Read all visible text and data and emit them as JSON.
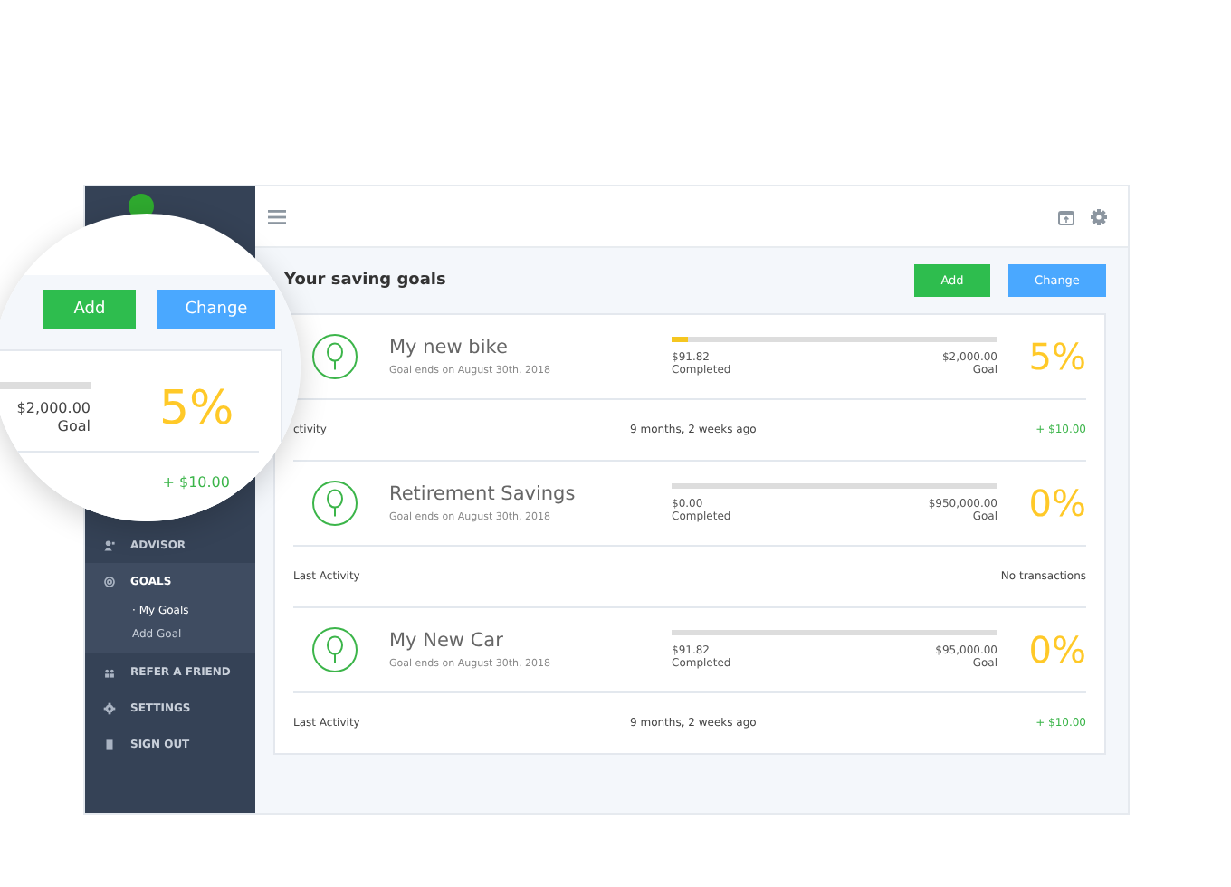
{
  "sidebar": {
    "items": [
      {
        "label": "ADVISOR",
        "kind": "advisor",
        "selected": false
      },
      {
        "label": "GOALS",
        "kind": "goals",
        "selected": true,
        "expanded": true,
        "children": [
          {
            "label": "· My Goals",
            "selected": true
          },
          {
            "label": "Add Goal",
            "selected": false
          }
        ]
      },
      {
        "label": "REFER A FRIEND",
        "kind": "refer",
        "selected": false
      },
      {
        "label": "SETTINGS",
        "kind": "settings",
        "selected": false
      },
      {
        "label": "SIGN OUT",
        "kind": "signout",
        "selected": false
      }
    ]
  },
  "header": {
    "title": "Your saving goals",
    "buttons": [
      {
        "label": "Add",
        "kind": "add"
      },
      {
        "label": "Change",
        "kind": "change"
      }
    ]
  },
  "goals": [
    {
      "name": "My new bike",
      "ends": "Goal ends on August 30th, 2018",
      "completed": "$91.82",
      "completed_label": "Completed",
      "goal": "$2,000.00",
      "goal_label": "Goal",
      "level": 0.05,
      "percent": "5%",
      "activity": {
        "label": "ctivity",
        "time": "9 months, 2 weeks ago",
        "value": "+ $10.00",
        "color": "#3cb54a"
      }
    },
    {
      "name": "Retirement Savings",
      "ends": "Goal ends on August 30th, 2018",
      "completed": "$0.00",
      "completed_label": "Completed",
      "goal": "$950,000.00",
      "goal_label": "Goal",
      "level": 0,
      "percent": "0%",
      "activity": {
        "label": "Last Activity",
        "value": "No transactions",
        "color": "#444444"
      }
    },
    {
      "name": "My New Car",
      "ends": "Goal ends on August 30th, 2018",
      "completed": "$91.82",
      "completed_label": "Completed",
      "goal": "$95,000.00",
      "goal_label": "Goal",
      "level": 0,
      "percent": "0%",
      "activity": {
        "label": "Last Activity",
        "time": "9 months, 2 weeks ago",
        "value": "+ $10.00",
        "color": "#3cb54a"
      }
    }
  ],
  "magnifier": {
    "buttons": [
      {
        "label": "Add",
        "kind": "add"
      },
      {
        "label": "Change",
        "kind": "change"
      }
    ],
    "goal": "$2,000.00",
    "goal_label": "Goal",
    "percent": "5%",
    "activity": {
      "value": "+ $10.00",
      "color": "#3cb54a"
    }
  }
}
